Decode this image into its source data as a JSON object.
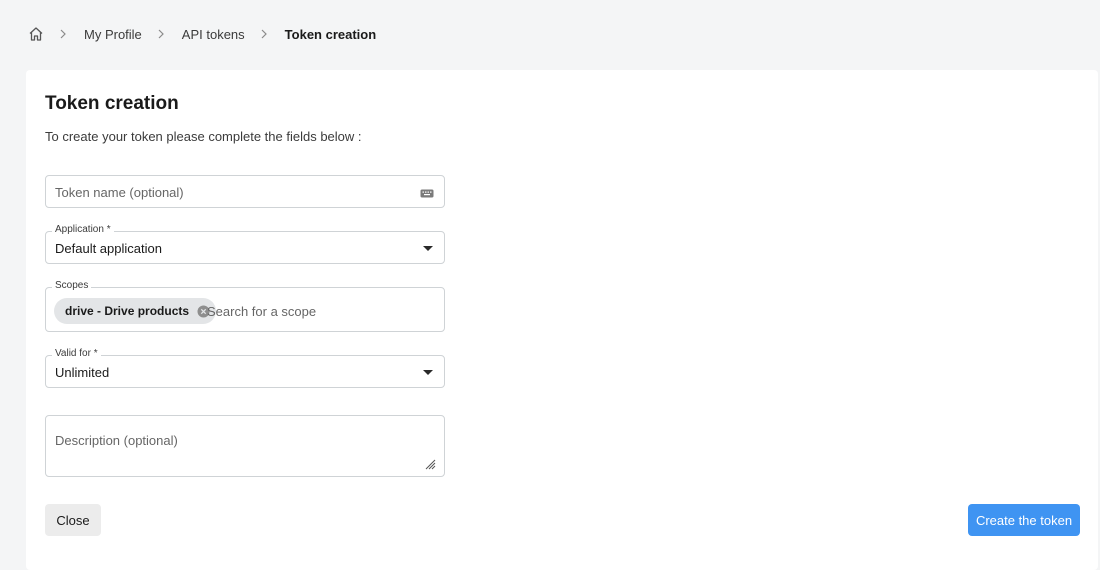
{
  "breadcrumb": {
    "home_icon": "home-icon",
    "items": [
      "My Profile",
      "API tokens"
    ],
    "current": "Token creation"
  },
  "page": {
    "title": "Token creation",
    "subtitle": "To create your token please complete the fields below :"
  },
  "form": {
    "token_name": {
      "placeholder": "Token name (optional)",
      "value": "",
      "icon": "keyboard-icon"
    },
    "application": {
      "label": "Application *",
      "value": "Default application"
    },
    "scopes": {
      "label": "Scopes",
      "chips": [
        "drive - Drive products"
      ],
      "search_placeholder": "Search for a scope"
    },
    "valid_for": {
      "label": "Valid for *",
      "value": "Unlimited"
    },
    "description": {
      "placeholder": "Description (optional)",
      "value": ""
    }
  },
  "actions": {
    "close_label": "Close",
    "create_label": "Create the token"
  },
  "colors": {
    "background": "#f4f5f6",
    "card": "#ffffff",
    "primary": "#3f94f2",
    "secondary_button": "#ececec",
    "chip": "#e3e5e7",
    "border": "#cfd3d6"
  }
}
